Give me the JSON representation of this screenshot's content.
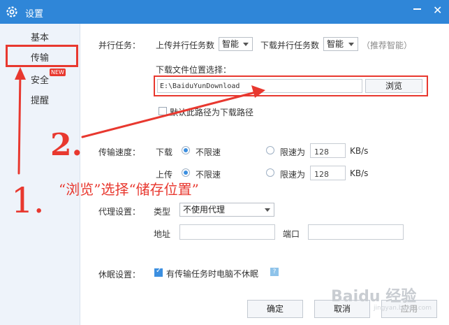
{
  "window": {
    "title": "设置",
    "close_glyph": "✕",
    "accent": "#2f86d8"
  },
  "sidebar": {
    "items": [
      {
        "label": "基本"
      },
      {
        "label": "传输"
      },
      {
        "label": "安全",
        "badge": "NEW"
      },
      {
        "label": "提醒"
      }
    ]
  },
  "tasks": {
    "label": "并行任务：",
    "upload_label": "上传并行任务数",
    "upload_value": "智能",
    "download_label": "下载并行任务数",
    "download_value": "智能",
    "hint": "（推荐智能）"
  },
  "download_location": {
    "label": "下载文件位置选择：",
    "path": "E:\\BaiduYunDownload",
    "browse_label": "浏览",
    "default_label": "默认此路径为下载路径",
    "default_checked": false
  },
  "speed": {
    "label": "传输速度：",
    "download": {
      "label": "下载",
      "unlimited": "不限速",
      "limited": "限速为",
      "value": "128",
      "unit": "KB/s"
    },
    "upload": {
      "label": "上传",
      "unlimited": "不限速",
      "limited": "限速为",
      "value": "128",
      "unit": "KB/s"
    }
  },
  "proxy": {
    "label": "代理设置：",
    "type_label": "类型",
    "type_value": "不使用代理",
    "address_label": "地址",
    "port_label": "端口"
  },
  "sleep": {
    "label": "休眠设置：",
    "option_label": "有传输任务时电脑不休眠",
    "checked": true,
    "help_glyph": "?"
  },
  "footer": {
    "ok": "确定",
    "cancel": "取消",
    "apply": "应用"
  },
  "annotation": {
    "instruction": "“浏览”选择“储存位置”",
    "step1": "1.",
    "step2": "2.",
    "color": "#e8382f"
  },
  "watermark": {
    "text": "Baidu 经验",
    "site": "jingyan.baidu.com"
  }
}
